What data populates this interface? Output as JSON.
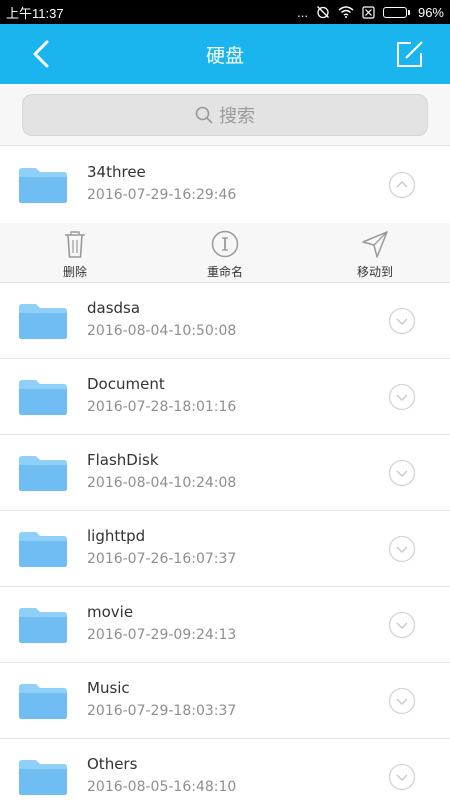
{
  "status_bar": {
    "time": "上午11:37",
    "dots": "...",
    "battery": "96%",
    "battery_level": 0.96
  },
  "app_bar": {
    "title": "硬盘",
    "back_icon": "chevron-left-icon",
    "edit_icon": "edit-icon"
  },
  "search": {
    "placeholder": "搜索"
  },
  "expanded_row": {
    "name": "34three",
    "date": "2016-07-29-16:29:46"
  },
  "actions": [
    {
      "label": "删除",
      "icon": "trash-icon"
    },
    {
      "label": "重命名",
      "icon": "info-icon"
    },
    {
      "label": "移动到",
      "icon": "send-icon"
    }
  ],
  "files": [
    {
      "name": "dasdsa",
      "date": "2016-08-04-10:50:08"
    },
    {
      "name": "Document",
      "date": "2016-07-28-18:01:16"
    },
    {
      "name": "FlashDisk",
      "date": "2016-08-04-10:24:08"
    },
    {
      "name": "lighttpd",
      "date": "2016-07-26-16:07:37"
    },
    {
      "name": "movie",
      "date": "2016-07-29-09:24:13"
    },
    {
      "name": "Music",
      "date": "2016-07-29-18:03:37"
    },
    {
      "name": "Others",
      "date": "2016-08-05-16:48:10"
    }
  ],
  "colors": {
    "accent": "#1ab5ee",
    "folder": "#72c2f5"
  }
}
